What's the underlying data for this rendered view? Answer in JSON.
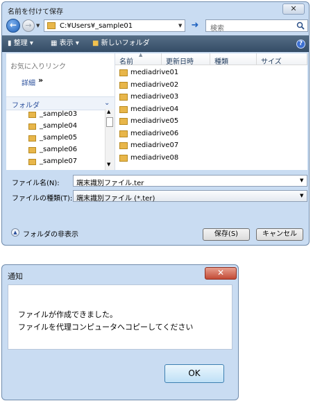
{
  "save_dialog": {
    "title": "名前を付けて保存",
    "close_label": "✕",
    "address_path": "C:¥Users¥_sample01",
    "search_placeholder": "検索",
    "toolbar": {
      "organize_label": "整理",
      "view_label": "表示",
      "new_folder_label": "新しいフォルダ",
      "help_label": "?"
    },
    "nav": {
      "favorites_label": "お気に入りリンク",
      "details_label": "詳細",
      "details_chevron": "»",
      "folders_label": "フォルダ",
      "tree_items": [
        "_sample03",
        "_sample04",
        "_sample05",
        "_sample06",
        "_sample07"
      ]
    },
    "columns": [
      "名前",
      "更新日時",
      "種類",
      "サイズ"
    ],
    "files": [
      "mediadrive01",
      "mediadrive02",
      "mediadrive03",
      "mediadrive04",
      "mediadrive05",
      "mediadrive06",
      "mediadrive07",
      "mediadrive08"
    ],
    "filename_label": "ファイル名(N):",
    "filename_value": "端末識別ファイル.ter",
    "filetype_label": "ファイルの種類(T):",
    "filetype_value": "端末識別ファイル (*.ter)",
    "hide_folders_label": "フォルダの非表示",
    "save_button": "保存(S)",
    "cancel_button": "キャンセル"
  },
  "notice_dialog": {
    "title": "通知",
    "close_label": "✕",
    "message_line1": "ファイルが作成できました。",
    "message_line2": "ファイルを代理コンピュータへコピーしてください",
    "ok_button": "OK"
  }
}
